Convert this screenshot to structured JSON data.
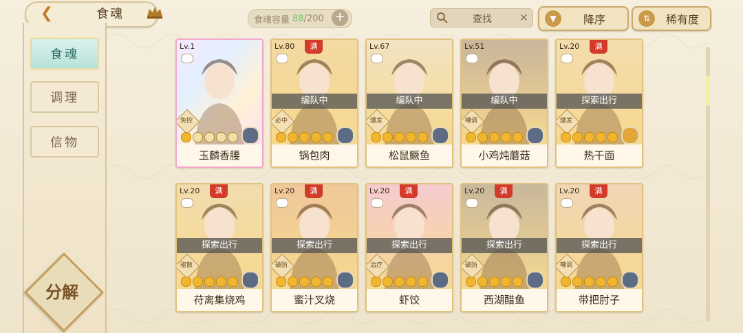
{
  "header": {
    "title": "食魂",
    "capacity_label": "食魂容量",
    "capacity_current": "88",
    "capacity_total": "/200",
    "search_label": "查找",
    "sort_order": "降序",
    "sort_by": "稀有度"
  },
  "sidebar": {
    "items": [
      {
        "label": "食魂",
        "active": true
      },
      {
        "label": "调理",
        "active": false
      },
      {
        "label": "信物",
        "active": false
      }
    ],
    "decompose_label": "分解"
  },
  "cards": [
    {
      "level": "Lv.1",
      "name": "玉麟香腰",
      "status": "",
      "role": "免控",
      "full": false,
      "stars": 1,
      "rainbow": true,
      "element": "blue",
      "portrait_color": "#e9d6f3"
    },
    {
      "level": "Lv.80",
      "name": "锅包肉",
      "status": "编队中",
      "role": "必中",
      "full": true,
      "full_label": "满",
      "stars": 5,
      "rainbow": false,
      "element": "blue",
      "portrait_color": "#f4d9a2"
    },
    {
      "level": "Lv.67",
      "name": "松鼠鳜鱼",
      "status": "编队中",
      "role": "爆发",
      "full": false,
      "stars": 5,
      "rainbow": false,
      "element": "blue",
      "portrait_color": "#f2e3c2"
    },
    {
      "level": "Lv.51",
      "name": "小鸡炖蘑菇",
      "status": "编队中",
      "role": "嘲讽",
      "full": false,
      "stars": 5,
      "rainbow": false,
      "element": "blue",
      "portrait_color": "#c9b59a"
    },
    {
      "level": "Lv.20",
      "name": "热干面",
      "status": "探索出行",
      "role": "爆发",
      "full": true,
      "full_label": "满",
      "stars": 5,
      "rainbow": false,
      "element": "yellow",
      "portrait_color": "#f3dcae"
    },
    {
      "level": "Lv.20",
      "name": "苻离集烧鸡",
      "status": "探索出行",
      "role": "驱散",
      "full": true,
      "full_label": "满",
      "stars": 5,
      "rainbow": false,
      "element": "blue",
      "portrait_color": "#f2dcae"
    },
    {
      "level": "Lv.20",
      "name": "蜜汁叉烧",
      "status": "探索出行",
      "role": "破防",
      "full": true,
      "full_label": "满",
      "stars": 5,
      "rainbow": false,
      "element": "blue",
      "portrait_color": "#f0c79a"
    },
    {
      "level": "Lv.20",
      "name": "虾饺",
      "status": "探索出行",
      "role": "治疗",
      "full": true,
      "full_label": "满",
      "stars": 5,
      "rainbow": false,
      "element": "blue",
      "portrait_color": "#f6cbd0"
    },
    {
      "level": "Lv.20",
      "name": "西湖醋鱼",
      "status": "探索出行",
      "role": "破防",
      "full": true,
      "full_label": "满",
      "stars": 5,
      "rainbow": false,
      "element": "blue",
      "portrait_color": "#c8b79c"
    },
    {
      "level": "Lv.20",
      "name": "带把肘子",
      "status": "探索出行",
      "role": "嘲讽",
      "full": true,
      "full_label": "满",
      "stars": 5,
      "rainbow": false,
      "element": "blue",
      "portrait_color": "#f1d6b6"
    }
  ]
}
